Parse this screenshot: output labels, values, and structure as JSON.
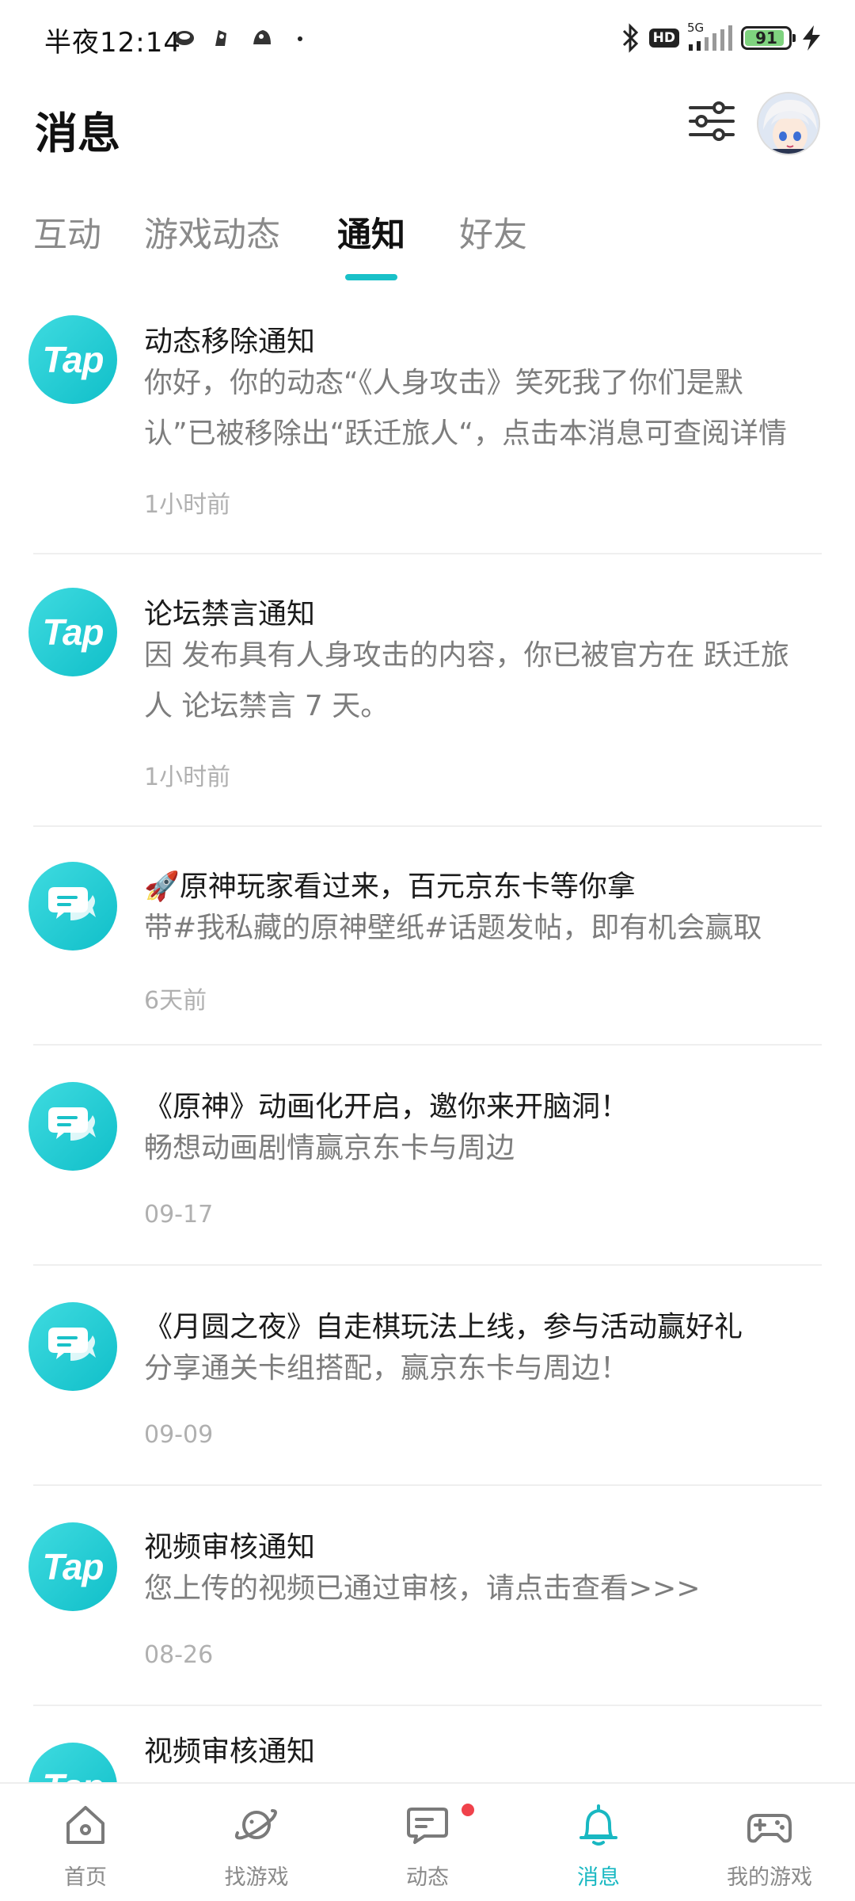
{
  "status_bar": {
    "time": "半夜12:14",
    "hd": "HD",
    "network": "5G",
    "battery": "91",
    "battery_level": 0.91
  },
  "header": {
    "title": "消息"
  },
  "tabs": [
    {
      "label": "互动",
      "active": false
    },
    {
      "label": "游戏动态",
      "active": false
    },
    {
      "label": "通知",
      "active": true
    },
    {
      "label": "好友",
      "active": false
    }
  ],
  "logo_text": "Tap",
  "notifications": [
    {
      "icon": "tap-logo",
      "title": "动态移除通知",
      "body": "你好，你的动态“《人身攻击》笑死我了你们是默认”已被移除出“跃迁旅人“，点击本消息可查阅详情",
      "time": "1小时前"
    },
    {
      "icon": "tap-logo",
      "title": "论坛禁言通知",
      "body": "因 发布具有人身攻击的内容，你已被官方在 跃迁旅人 论坛禁言 7 天。",
      "time": "1小时前"
    },
    {
      "icon": "chat-bubble",
      "title": "🚀原神玩家看过来，百元京东卡等你拿",
      "body": "带#我私藏的原神壁纸#话题发帖，即有机会赢取",
      "time": "6天前"
    },
    {
      "icon": "chat-bubble",
      "title": "《原神》动画化开启，邀你来开脑洞！",
      "body": "畅想动画剧情赢京东卡与周边",
      "time": "09-17"
    },
    {
      "icon": "chat-bubble",
      "title": "《月圆之夜》自走棋玩法上线，参与活动赢好礼",
      "body": "分享通关卡组搭配，赢京东卡与周边！",
      "time": "09-09"
    },
    {
      "icon": "tap-logo",
      "title": "视频审核通知",
      "body": "您上传的视频已通过审核，请点击查看>>>",
      "time": "08-26"
    },
    {
      "icon": "tap-logo",
      "title": "视频审核通知"
    }
  ],
  "bottom_nav": [
    {
      "label": "首页",
      "icon": "home-icon",
      "active": false
    },
    {
      "label": "找游戏",
      "icon": "planet-icon",
      "active": false
    },
    {
      "label": "动态",
      "icon": "chat-icon",
      "active": false,
      "badge": true
    },
    {
      "label": "消息",
      "icon": "bell-icon",
      "active": true
    },
    {
      "label": "我的游戏",
      "icon": "gamepad-icon",
      "active": false
    }
  ],
  "colors": {
    "accent": "#19c1c8",
    "badge": "#f0424b"
  }
}
